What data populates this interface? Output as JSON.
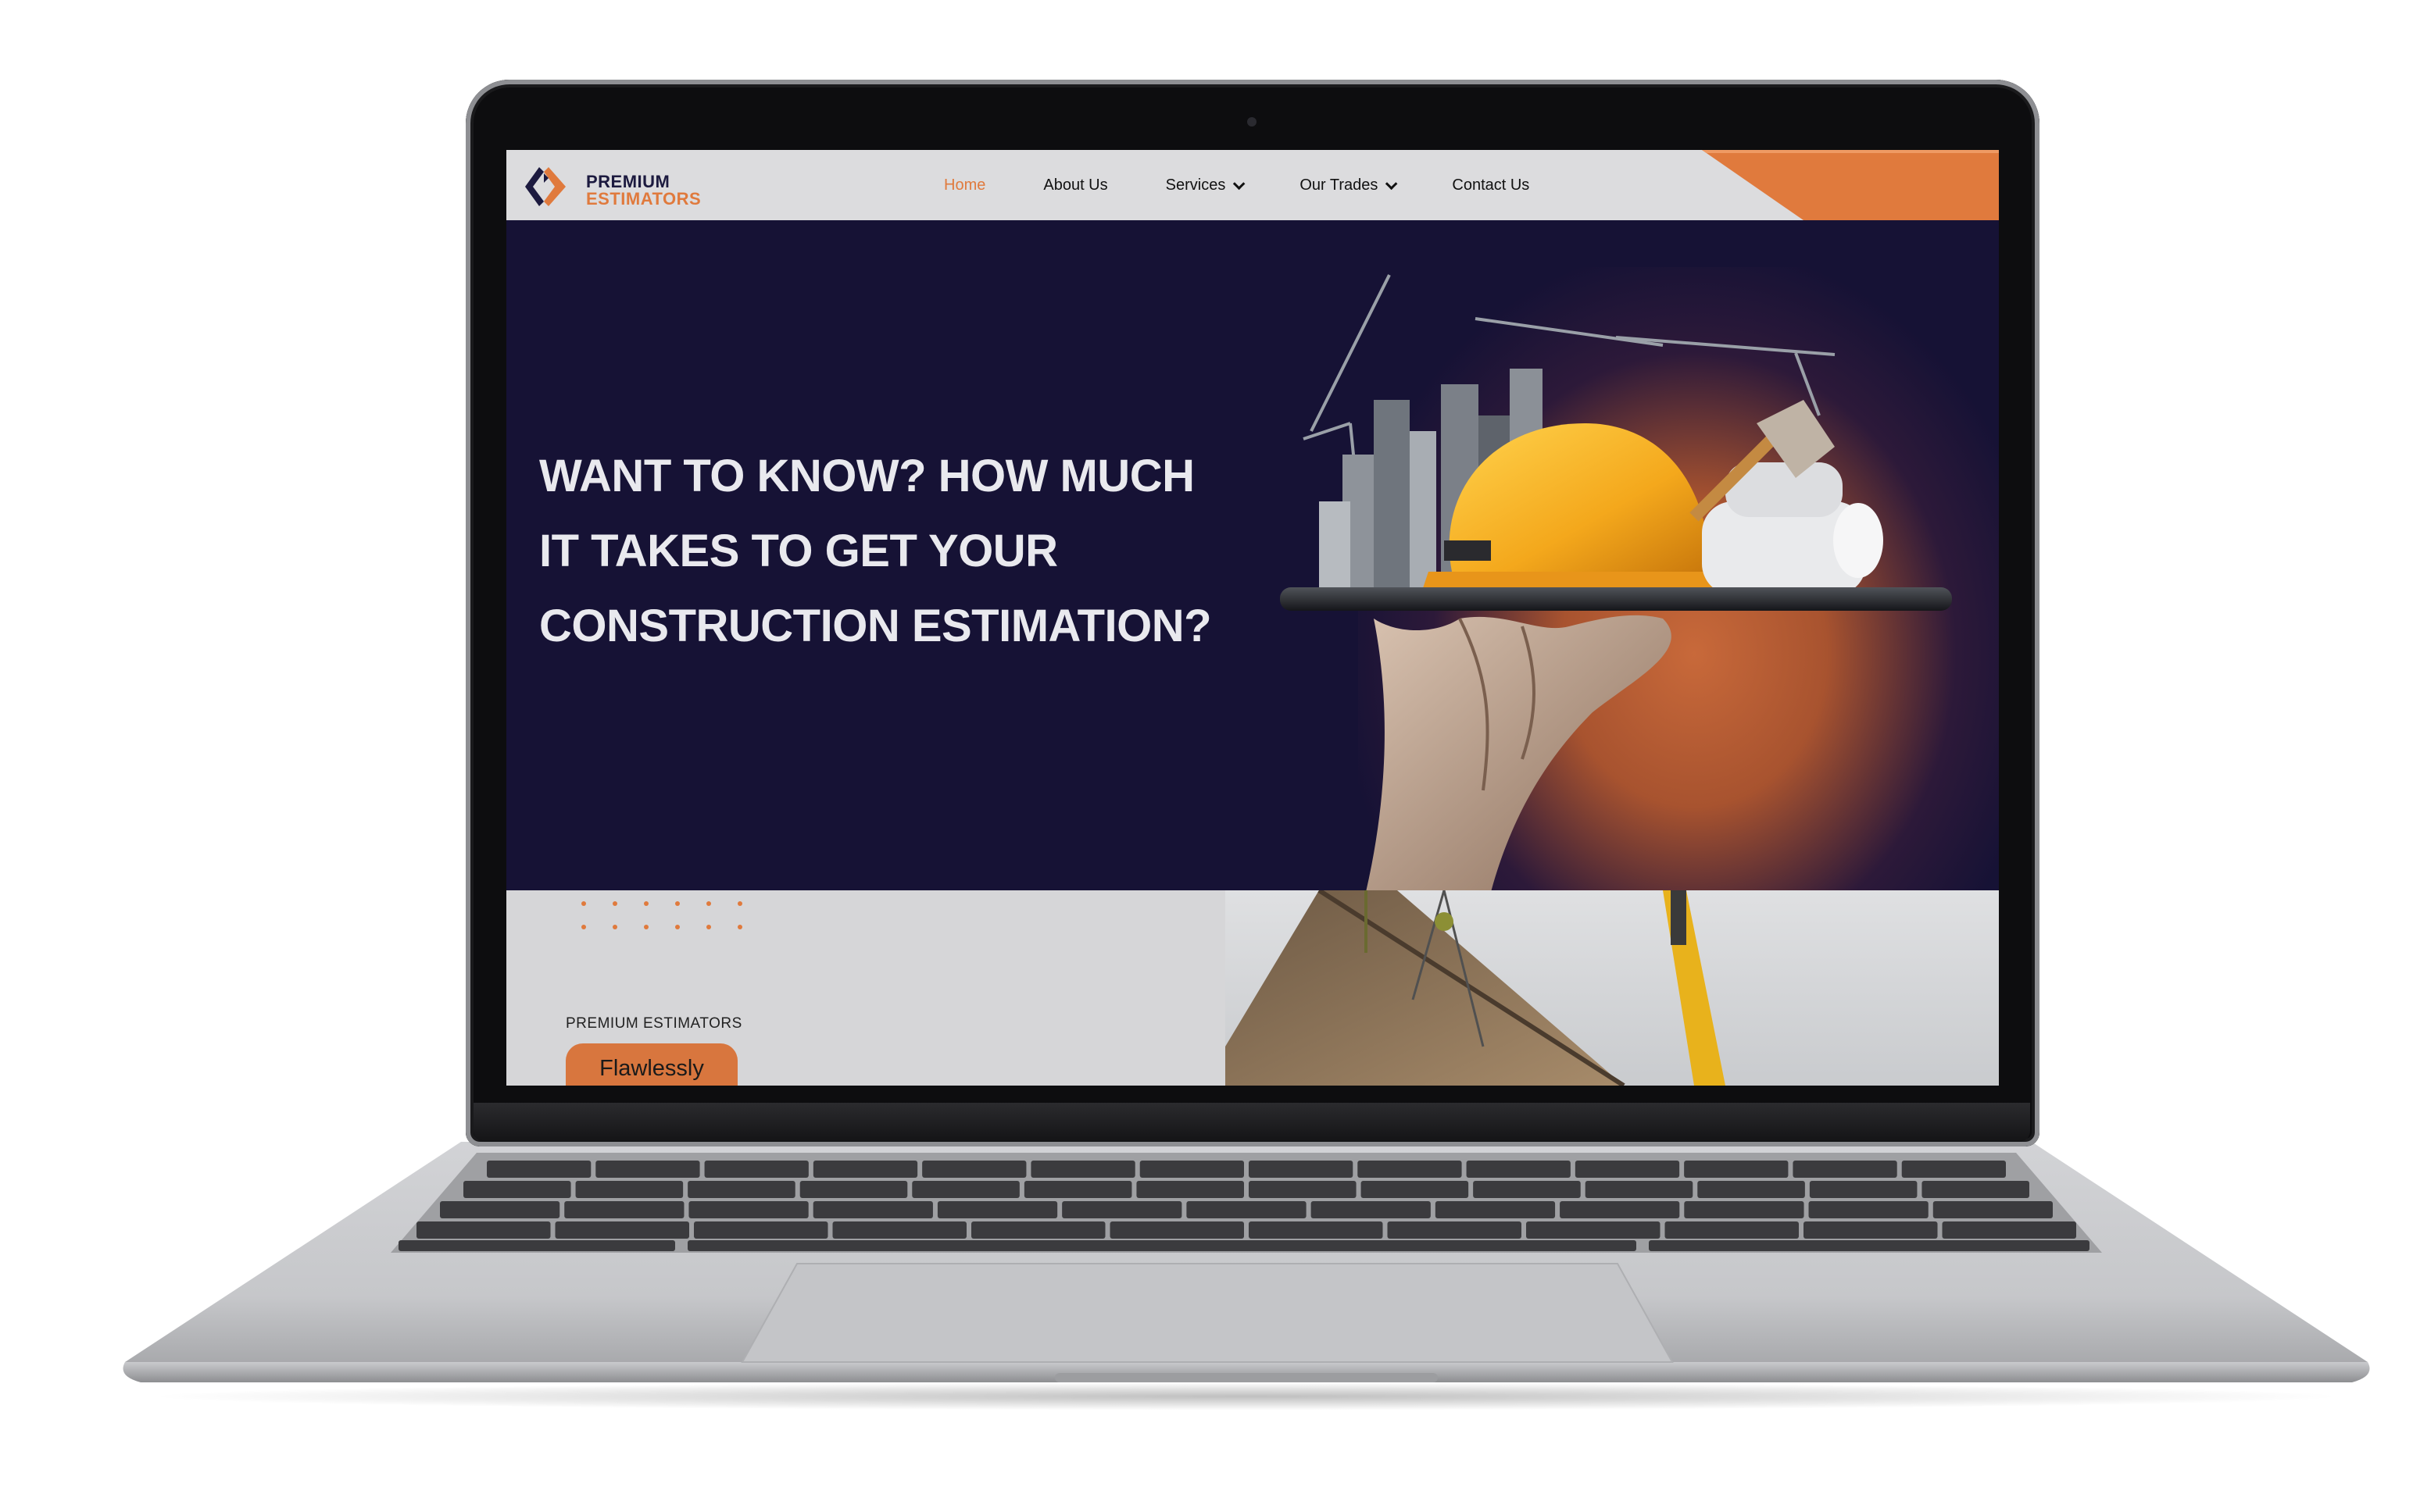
{
  "brand": {
    "name_line1": "PREMIUM",
    "name_line2": "ESTIMATORS",
    "colors": {
      "navy": "#161235",
      "orange": "#e07a3d",
      "nav_bg": "#dcdcde"
    },
    "logo_icon": "diamond-chevron-logo-icon"
  },
  "nav": {
    "items": [
      {
        "label": "Home",
        "active": true,
        "has_dropdown": false
      },
      {
        "label": "About Us",
        "active": false,
        "has_dropdown": false
      },
      {
        "label": "Services",
        "active": false,
        "has_dropdown": true
      },
      {
        "label": "Our Trades",
        "active": false,
        "has_dropdown": true
      },
      {
        "label": "Contact Us",
        "active": false,
        "has_dropdown": false
      }
    ]
  },
  "hero": {
    "title_line1": "WANT TO KNOW? HOW MUCH",
    "title_line2": "IT TAKES TO GET YOUR",
    "title_line3": "CONSTRUCTION ESTIMATION?"
  },
  "section2": {
    "label": "PREMIUM ESTIMATORS",
    "button": "Flawlessly"
  },
  "device": {
    "type": "laptop-mockup"
  }
}
